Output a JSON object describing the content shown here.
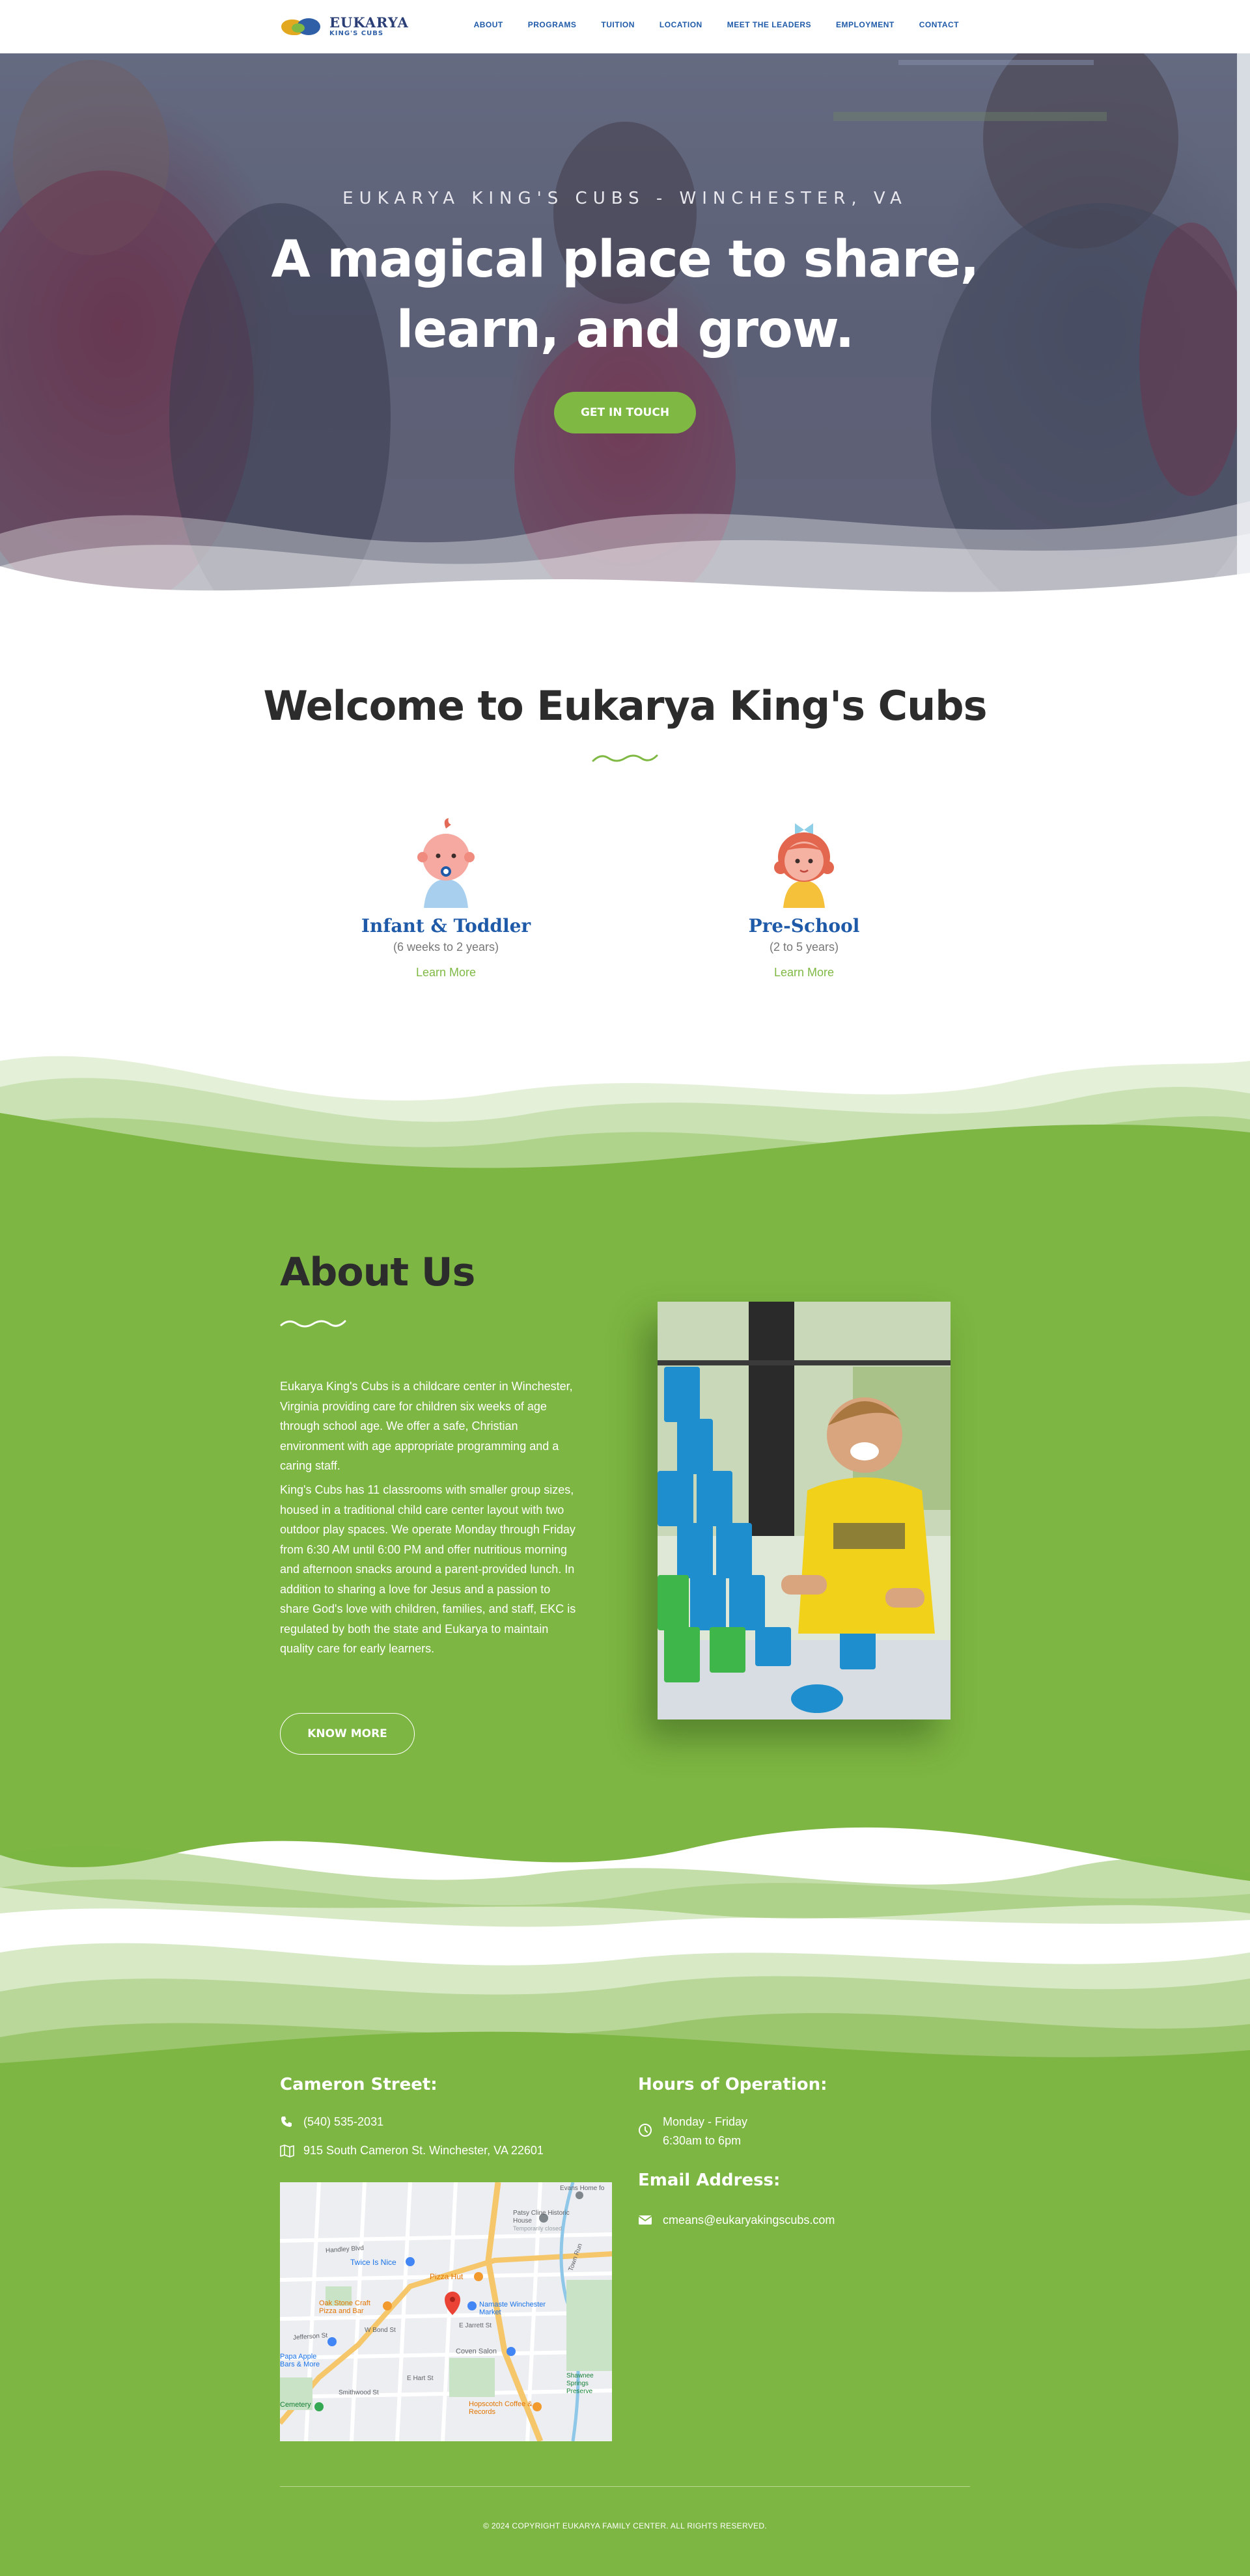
{
  "nav": {
    "logo_line1": "EUKARYA",
    "logo_line2": "KING'S CUBS",
    "items": [
      {
        "label": "ABOUT"
      },
      {
        "label": "PROGRAMS"
      },
      {
        "label": "TUITION"
      },
      {
        "label": "LOCATION"
      },
      {
        "label": "MEET THE LEADERS"
      },
      {
        "label": "EMPLOYMENT"
      },
      {
        "label": "CONTACT"
      }
    ]
  },
  "hero": {
    "eyebrow": "EUKARYA KING'S CUBS - WINCHESTER, VA",
    "title": "A magical place to share, learn, and grow.",
    "button": "GET IN TOUCH"
  },
  "welcome": {
    "title": "Welcome to Eukarya King's Cubs",
    "programs": [
      {
        "name": "Infant & Toddler",
        "age": "(6 weeks to 2 years)",
        "link": "Learn More"
      },
      {
        "name": "Pre-School",
        "age": "(2 to 5 years)",
        "link": "Learn More"
      }
    ]
  },
  "about": {
    "title": "About Us",
    "paragraph1": "Eukarya King's Cubs is a childcare center in Winchester, Virginia providing care for children six weeks of age through school age. We offer a safe, Christian environment with age appropriate programming and a caring staff.",
    "paragraph2": "King's Cubs has 11 classrooms with smaller group sizes, housed in a traditional child care center layout with two outdoor play spaces. We operate Monday through Friday from 6:30 AM until 6:00 PM and offer nutritious morning and afternoon snacks around a parent-provided lunch. In addition to sharing a love for Jesus and a passion to share God's love with children, families, and staff, EKC is regulated by both the state and Eukarya to maintain quality care for early learners.",
    "button": "KNOW MORE"
  },
  "footer": {
    "location_heading": "Cameron Street:",
    "phone": "(540) 535-2031",
    "address": "915 South Cameron St. Winchester, VA 22601",
    "hours_heading": "Hours of Operation:",
    "hours_days": "Monday - Friday",
    "hours_time": "6:30am to 6pm",
    "email_heading": "Email Address:",
    "email": "cmeans@eukaryakingscubs.com",
    "copyright": "© 2024 COPYRIGHT EUKARYA FAMILY CENTER. ALL RIGHTS RESERVED."
  },
  "map": {
    "labels": [
      "Evans Home fo",
      "Patsy Cline Historic House",
      "Temporarily closed",
      "Handley Blvd",
      "Twice Is Nice",
      "Pizza Hut",
      "Oak Stone Craft Pizza and Bar",
      "Namaste Winchester Market",
      "W Bond St",
      "E Jarrett St",
      "Jefferson St",
      "Papa Apple Bars & More",
      "Coven Salon",
      "Shawnee Springs Preserve",
      "Hopscotch Coffee & Records",
      "Cemetery",
      "E Hart St",
      "Smithwood St",
      "Town Run"
    ]
  },
  "colors": {
    "brand_green": "#7db642",
    "brand_blue": "#1f5aa8",
    "dark_text": "#2c2c2c"
  }
}
